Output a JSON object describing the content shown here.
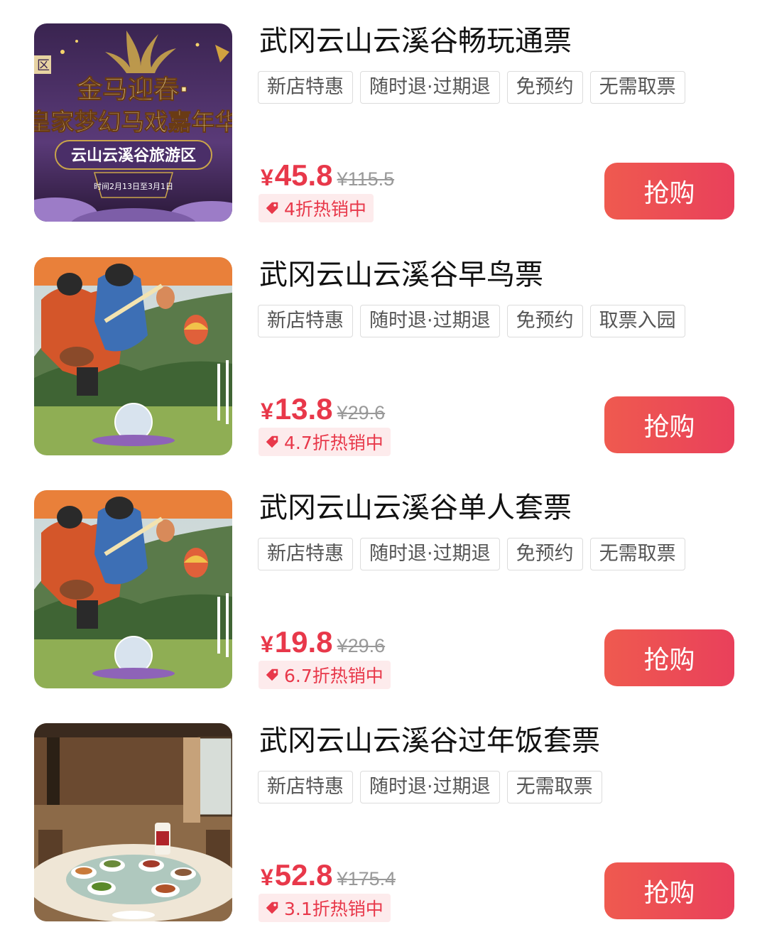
{
  "products": [
    {
      "title": "武冈云山云溪谷畅玩通票",
      "tags": [
        "新店特惠",
        "随时退·过期退",
        "免预约",
        "无需取票"
      ],
      "price_symbol": "¥",
      "price": "45.8",
      "original_price": "¥115.5",
      "discount": "4折热销中",
      "buy_label": "抢购",
      "image": {
        "badge": "区",
        "headline_1": "金马迎春·",
        "headline_2": "皇家梦幻马戏嘉年华",
        "subtitle": "云山云溪谷旅游区",
        "date": "时间2月13日至3月1日"
      }
    },
    {
      "title": "武冈云山云溪谷早鸟票",
      "tags": [
        "新店特惠",
        "随时退·过期退",
        "免预约",
        "取票入园"
      ],
      "price_symbol": "¥",
      "price": "13.8",
      "original_price": "¥29.6",
      "discount": "4.7折热销中",
      "buy_label": "抢购"
    },
    {
      "title": "武冈云山云溪谷单人套票",
      "tags": [
        "新店特惠",
        "随时退·过期退",
        "免预约",
        "无需取票"
      ],
      "price_symbol": "¥",
      "price": "19.8",
      "original_price": "¥29.6",
      "discount": "6.7折热销中",
      "buy_label": "抢购"
    },
    {
      "title": "武冈云山云溪谷过年饭套票",
      "tags": [
        "新店特惠",
        "随时退·过期退",
        "无需取票"
      ],
      "price_symbol": "¥",
      "price": "52.8",
      "original_price": "¥175.4",
      "discount": "3.1折热销中",
      "buy_label": "抢购"
    }
  ],
  "colors": {
    "accent": "#e8384a",
    "discount_bg": "#fdebec",
    "button_start": "#ef5a4f",
    "button_end": "#e9405b",
    "tag_border": "#dcdcdc"
  },
  "icons": {
    "discount": "price-tag-icon"
  }
}
